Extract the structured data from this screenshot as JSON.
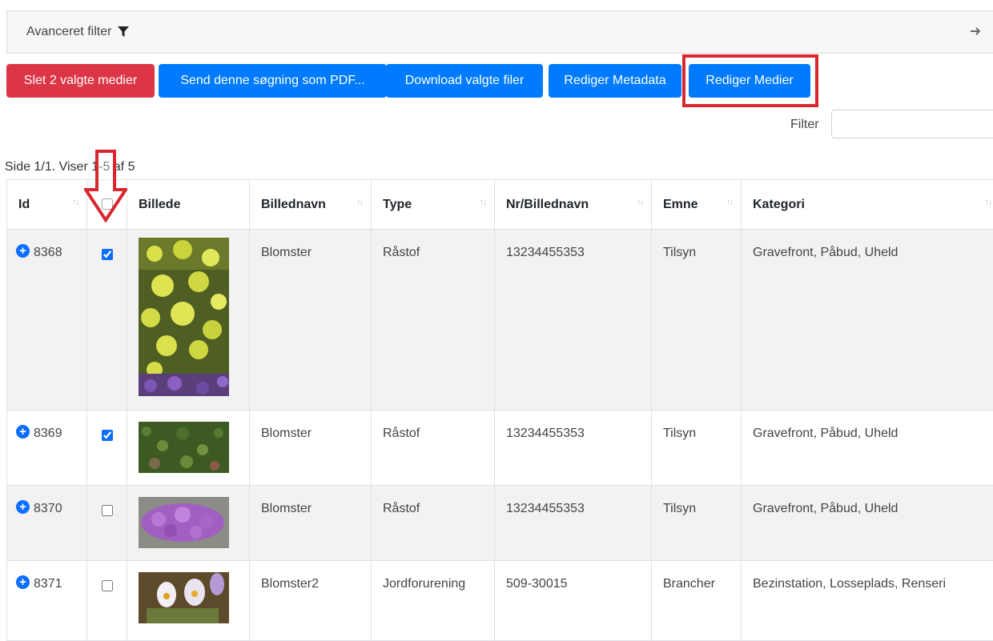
{
  "filter": {
    "label": "Avanceret filter"
  },
  "toolbar": {
    "delete_label": "Slet 2 valgte medier",
    "send_pdf_label": "Send denne søgning som PDF...",
    "download_label": "Download valgte filer",
    "edit_metadata_label": "Rediger Metadata",
    "edit_media_label": "Rediger Medier"
  },
  "table_filter": {
    "label": "Filter",
    "value": ""
  },
  "pagination": {
    "info": "Side 1/1. Viser 1-5 af 5"
  },
  "table": {
    "columns": [
      "Id",
      "",
      "Billede",
      "Billednavn",
      "Type",
      "Nr/Billednavn",
      "Emne",
      "Kategori"
    ],
    "rows": [
      {
        "id": "8368",
        "checked": true,
        "billednavn": "Blomster",
        "type": "Råstof",
        "nr": "13234455353",
        "emne": "Tilsyn",
        "kategori": "Gravefront, Påbud, Uheld"
      },
      {
        "id": "8369",
        "checked": true,
        "billednavn": "Blomster",
        "type": "Råstof",
        "nr": "13234455353",
        "emne": "Tilsyn",
        "kategori": "Gravefront, Påbud, Uheld"
      },
      {
        "id": "8370",
        "checked": false,
        "billednavn": "Blomster",
        "type": "Råstof",
        "nr": "13234455353",
        "emne": "Tilsyn",
        "kategori": "Gravefront, Påbud, Uheld"
      },
      {
        "id": "8371",
        "checked": false,
        "billednavn": "Blomster2",
        "type": "Jordforurening",
        "nr": "509-30015",
        "emne": "Brancher",
        "kategori": "Bezinstation, Losseplads, Renseri"
      }
    ]
  },
  "colors": {
    "danger": "#dc3545",
    "primary": "#007bff",
    "annotation": "#d9262f"
  }
}
